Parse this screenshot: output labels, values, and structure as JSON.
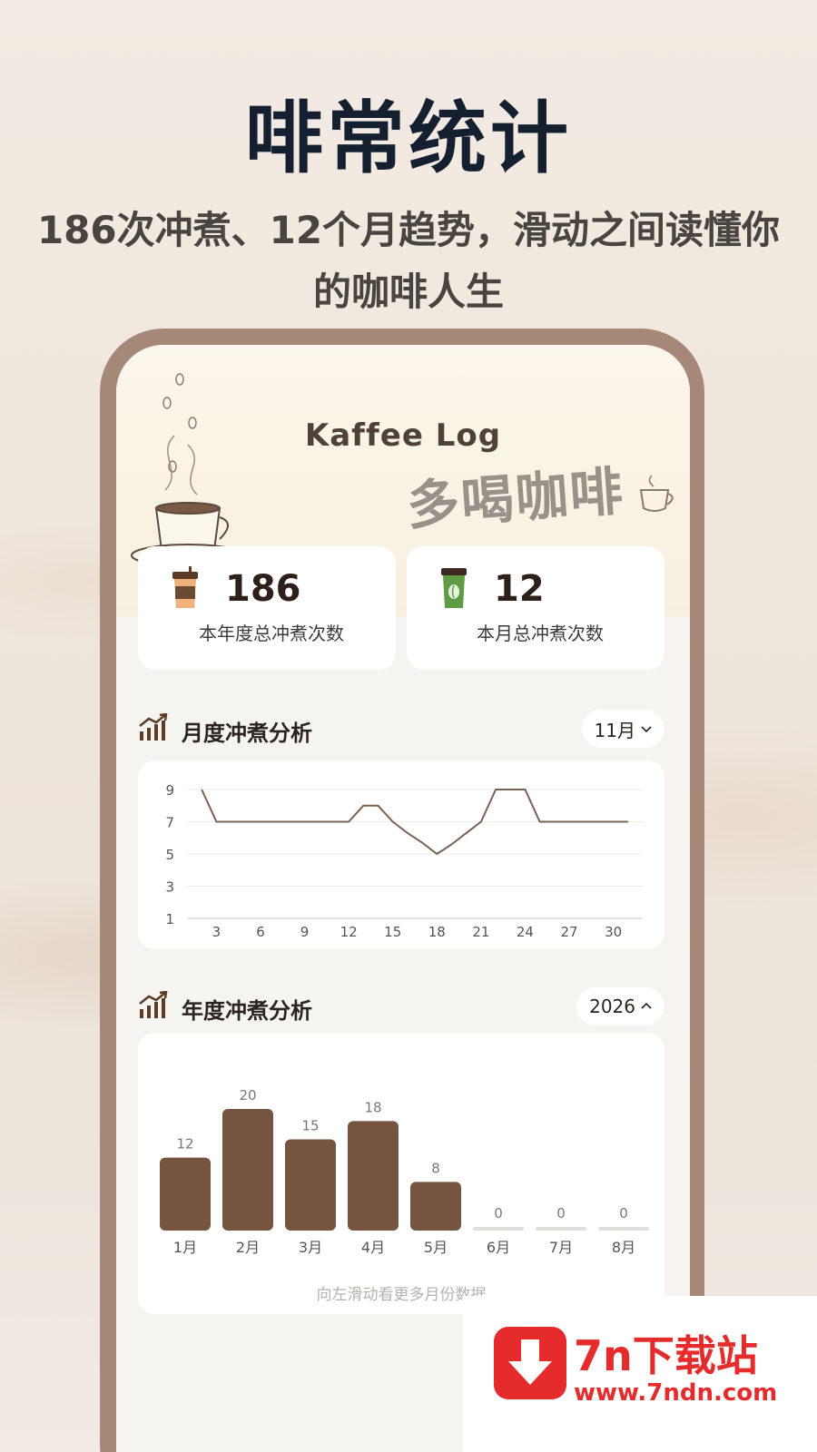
{
  "promo": {
    "headline": "啡常统计",
    "subline": "186次冲煮、12个月趋势，滑动之间读懂你的咖啡人生"
  },
  "app": {
    "title": "Kaffee Log",
    "decor_text": "多喝咖啡"
  },
  "stats": [
    {
      "icon": "takeaway-cup-icon",
      "value": "186",
      "label": "本年度总冲煮次数"
    },
    {
      "icon": "green-coffee-cup-icon",
      "value": "12",
      "label": "本月总冲煮次数"
    }
  ],
  "monthly": {
    "title": "月度冲煮分析",
    "selector": "11月"
  },
  "yearly": {
    "title": "年度冲煮分析",
    "selector": "2026",
    "hint": "向左滑动看更多月份数据"
  },
  "colors": {
    "accent": "#765440",
    "line": "#7a6152",
    "empty_bar": "#e3dfdc",
    "watermark": "#e52b2b"
  },
  "chart_data": [
    {
      "type": "line",
      "x": [
        2,
        3,
        4,
        5,
        6,
        7,
        8,
        9,
        10,
        11,
        12,
        13,
        14,
        15,
        16,
        17,
        18,
        19,
        20,
        21,
        22,
        23,
        24,
        25,
        26,
        27,
        28,
        29,
        30,
        31
      ],
      "series": [
        {
          "values": [
            9,
            7,
            7,
            7,
            7,
            7,
            7,
            7,
            7,
            7,
            7,
            8,
            8,
            7,
            6.3,
            5.7,
            5,
            5.6,
            6.3,
            7,
            9,
            9,
            9,
            7,
            7,
            7,
            7,
            7,
            7,
            7
          ]
        }
      ],
      "xticks": [
        3,
        6,
        9,
        12,
        15,
        18,
        21,
        24,
        27,
        30
      ],
      "yticks": [
        1,
        3,
        5,
        7,
        9
      ],
      "xlim": [
        1,
        32
      ],
      "ylim": [
        1,
        9
      ],
      "grid": true,
      "title": "",
      "xlabel": "",
      "ylabel": ""
    },
    {
      "type": "bar",
      "categories": [
        "1月",
        "2月",
        "3月",
        "4月",
        "5月",
        "6月",
        "7月",
        "8月"
      ],
      "values": [
        12,
        20,
        15,
        18,
        8,
        0,
        0,
        0
      ],
      "data_labels": [
        "12",
        "20",
        "15",
        "18",
        "8",
        "0",
        "0",
        "0"
      ],
      "ylim": [
        0,
        20
      ],
      "title": "",
      "xlabel": "",
      "ylabel": ""
    }
  ],
  "watermark": {
    "name": "7n下载站",
    "url": "www.7ndn.com"
  }
}
